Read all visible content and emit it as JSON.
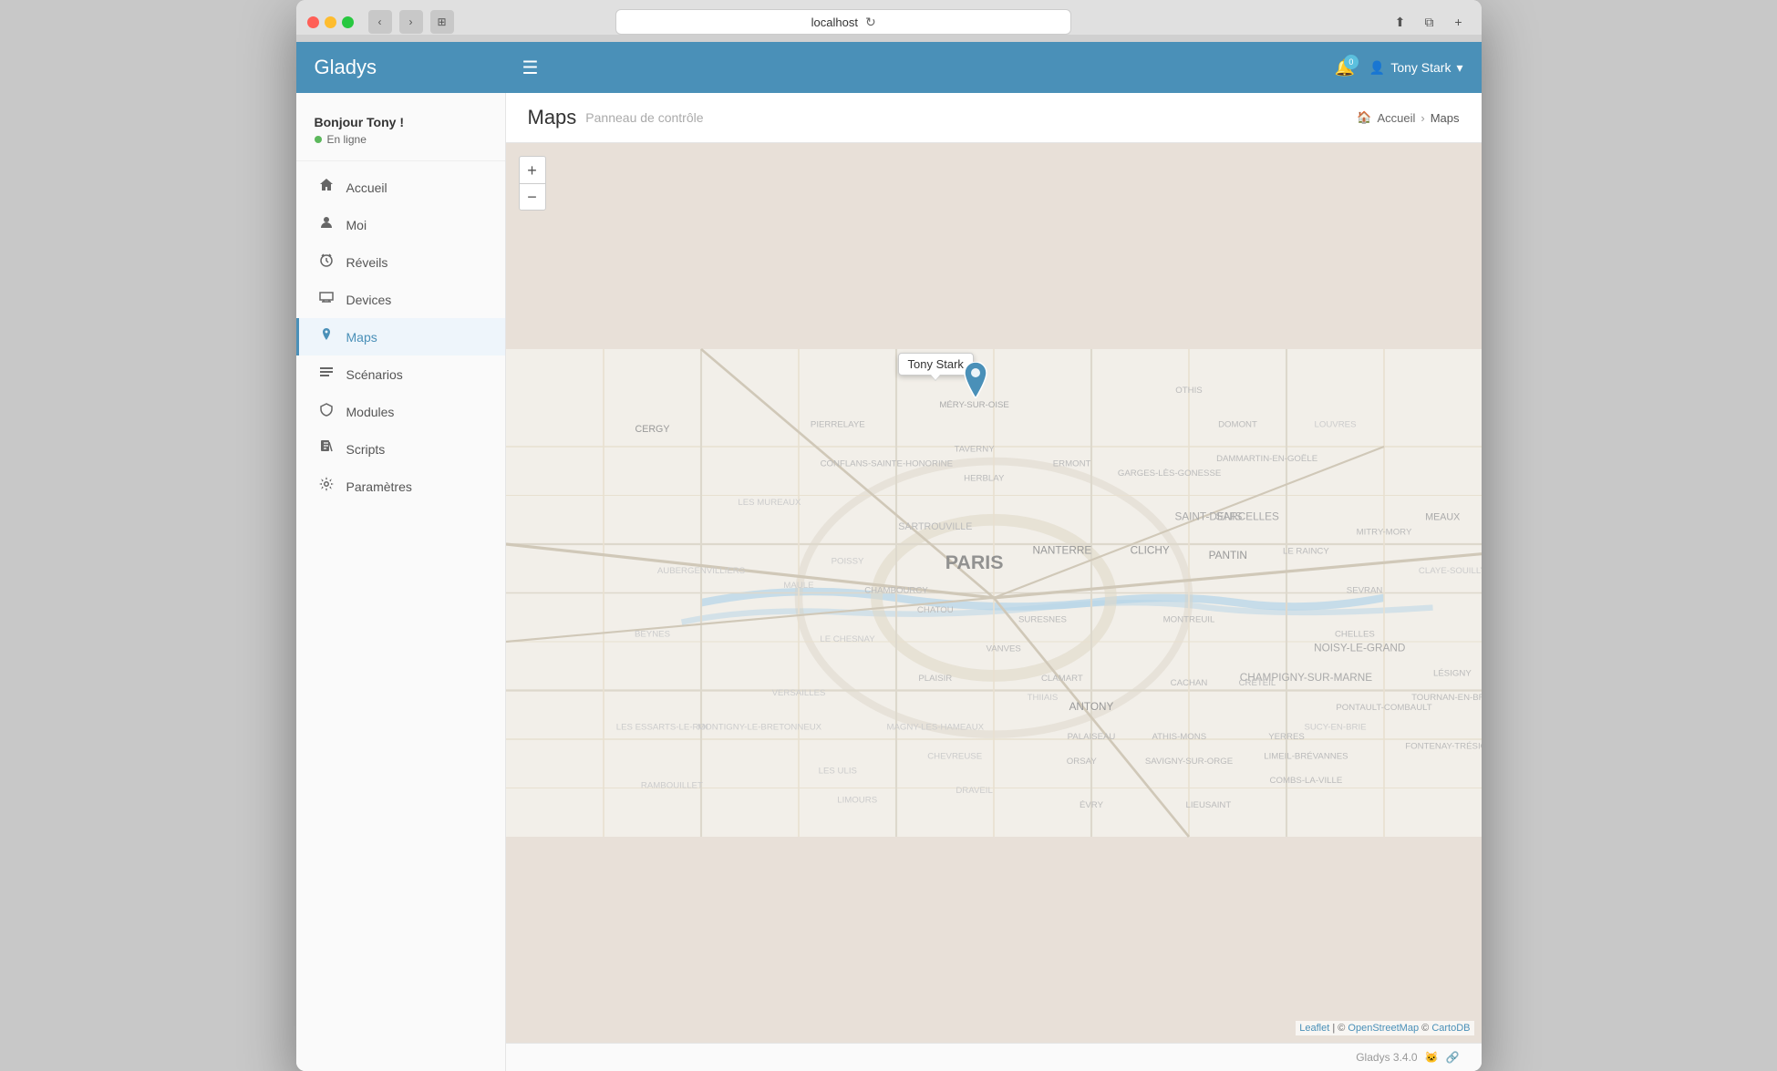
{
  "browser": {
    "url": "localhost",
    "tab_label": "localhost"
  },
  "app": {
    "brand": "Gladys",
    "version": "Gladys 3.4.0"
  },
  "header": {
    "notification_count": "0",
    "user_name": "Tony Stark",
    "hamburger_label": "☰"
  },
  "user": {
    "greeting": "Bonjour Tony !",
    "status": "En ligne"
  },
  "sidebar": {
    "items": [
      {
        "label": "Accueil",
        "icon": "🏠",
        "id": "accueil"
      },
      {
        "label": "Moi",
        "icon": "👤",
        "id": "moi"
      },
      {
        "label": "Réveils",
        "icon": "⏰",
        "id": "reveils"
      },
      {
        "label": "Devices",
        "icon": "📡",
        "id": "devices"
      },
      {
        "label": "Maps",
        "icon": "📍",
        "id": "maps",
        "active": true
      },
      {
        "label": "Scénarios",
        "icon": "📋",
        "id": "scenarios"
      },
      {
        "label": "Modules",
        "icon": "☁",
        "id": "modules"
      },
      {
        "label": "Scripts",
        "icon": "📄",
        "id": "scripts"
      },
      {
        "label": "Paramètres",
        "icon": "⚙",
        "id": "parametres"
      }
    ]
  },
  "page": {
    "title": "Maps",
    "subtitle": "Panneau de contrôle",
    "breadcrumb_home": "Accueil",
    "breadcrumb_current": "Maps"
  },
  "map": {
    "zoom_in": "+",
    "zoom_out": "−",
    "marker_label": "Tony Stark",
    "attribution": "Leaflet | © OpenStreetMap © CartoDB"
  },
  "footer": {
    "version": "Gladys 3.4.0"
  }
}
